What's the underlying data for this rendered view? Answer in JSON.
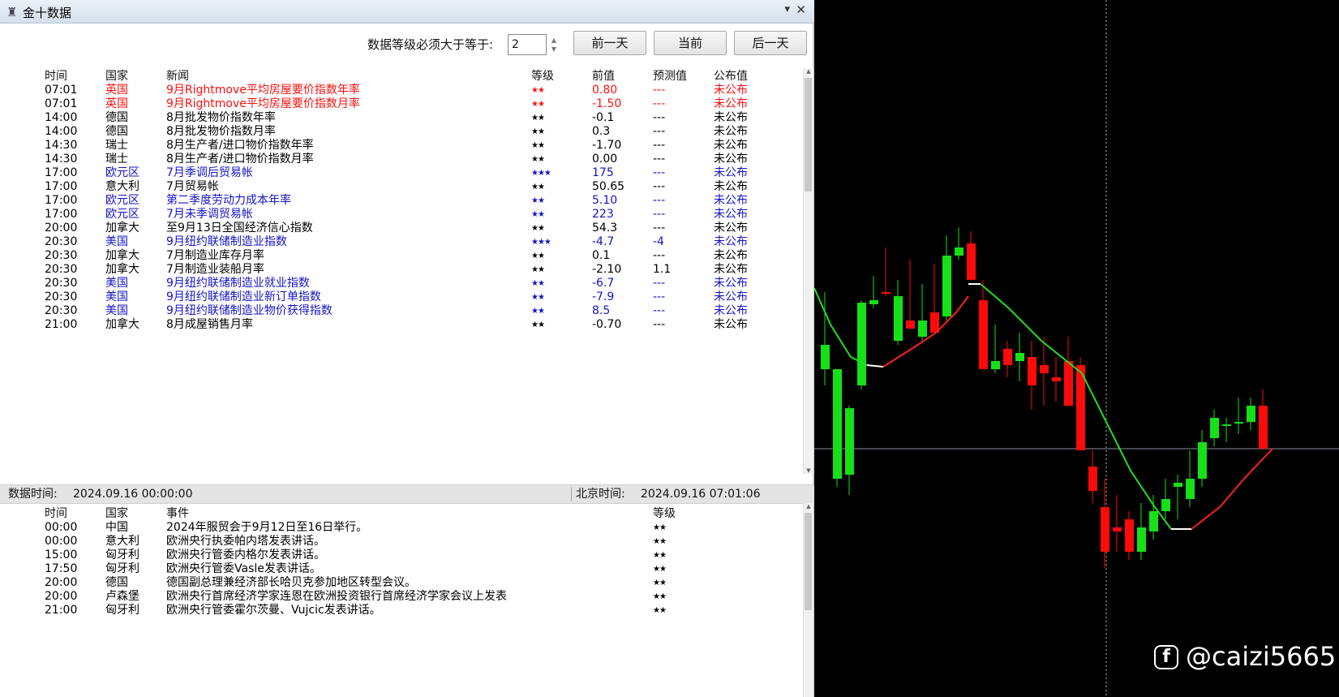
{
  "window": {
    "title": "金十数据",
    "pin_glyph": "▾",
    "close_glyph": "✕"
  },
  "filter": {
    "label": "数据等级必须大于等于:",
    "value": "2"
  },
  "nav": {
    "prev": "前一天",
    "current": "当前",
    "next": "后一天"
  },
  "news_headers": {
    "time": "时间",
    "country": "国家",
    "news": "新闻",
    "level": "等级",
    "prev": "前值",
    "forecast": "预测值",
    "published": "公布值"
  },
  "news_rows": [
    {
      "time": "07:01",
      "country": "英国",
      "news": "9月Rightmove平均房屋要价指数年率",
      "level": "★★",
      "prev": "0.80",
      "forecast": "---",
      "published": "未公布",
      "color": "red"
    },
    {
      "time": "07:01",
      "country": "英国",
      "news": "9月Rightmove平均房屋要价指数月率",
      "level": "★★",
      "prev": "-1.50",
      "forecast": "---",
      "published": "未公布",
      "color": "red"
    },
    {
      "time": "14:00",
      "country": "德国",
      "news": "8月批发物价指数年率",
      "level": "★★",
      "prev": "-0.1",
      "forecast": "---",
      "published": "未公布",
      "color": "black"
    },
    {
      "time": "14:00",
      "country": "德国",
      "news": "8月批发物价指数月率",
      "level": "★★",
      "prev": "0.3",
      "forecast": "---",
      "published": "未公布",
      "color": "black"
    },
    {
      "time": "14:30",
      "country": "瑞士",
      "news": "8月生产者/进口物价指数年率",
      "level": "★★",
      "prev": "-1.70",
      "forecast": "---",
      "published": "未公布",
      "color": "black"
    },
    {
      "time": "14:30",
      "country": "瑞士",
      "news": "8月生产者/进口物价指数月率",
      "level": "★★",
      "prev": "0.00",
      "forecast": "---",
      "published": "未公布",
      "color": "black"
    },
    {
      "time": "17:00",
      "country": "欧元区",
      "news": "7月季调后贸易帐",
      "level": "★★★",
      "prev": "175",
      "forecast": "---",
      "published": "未公布",
      "color": "blue"
    },
    {
      "time": "17:00",
      "country": "意大利",
      "news": "7月贸易帐",
      "level": "★★",
      "prev": "50.65",
      "forecast": "---",
      "published": "未公布",
      "color": "black"
    },
    {
      "time": "17:00",
      "country": "欧元区",
      "news": "第二季度劳动力成本年率",
      "level": "★★",
      "prev": "5.10",
      "forecast": "---",
      "published": "未公布",
      "color": "blue"
    },
    {
      "time": "17:00",
      "country": "欧元区",
      "news": "7月未季调贸易帐",
      "level": "★★",
      "prev": "223",
      "forecast": "---",
      "published": "未公布",
      "color": "blue"
    },
    {
      "time": "20:00",
      "country": "加拿大",
      "news": "至9月13日全国经济信心指数",
      "level": "★★",
      "prev": "54.3",
      "forecast": "---",
      "published": "未公布",
      "color": "black"
    },
    {
      "time": "20:30",
      "country": "美国",
      "news": "9月纽约联储制造业指数",
      "level": "★★★",
      "prev": "-4.7",
      "forecast": "-4",
      "published": "未公布",
      "color": "blue"
    },
    {
      "time": "20:30",
      "country": "加拿大",
      "news": "7月制造业库存月率",
      "level": "★★",
      "prev": "0.1",
      "forecast": "---",
      "published": "未公布",
      "color": "black"
    },
    {
      "time": "20:30",
      "country": "加拿大",
      "news": "7月制造业装船月率",
      "level": "★★",
      "prev": "-2.10",
      "forecast": "1.1",
      "published": "未公布",
      "color": "black"
    },
    {
      "time": "20:30",
      "country": "美国",
      "news": "9月纽约联储制造业就业指数",
      "level": "★★",
      "prev": "-6.7",
      "forecast": "---",
      "published": "未公布",
      "color": "blue"
    },
    {
      "time": "20:30",
      "country": "美国",
      "news": "9月纽约联储制造业新订单指数",
      "level": "★★",
      "prev": "-7.9",
      "forecast": "---",
      "published": "未公布",
      "color": "blue"
    },
    {
      "time": "20:30",
      "country": "美国",
      "news": "9月纽约联储制造业物价获得指数",
      "level": "★★",
      "prev": "8.5",
      "forecast": "---",
      "published": "未公布",
      "color": "blue"
    },
    {
      "time": "21:00",
      "country": "加拿大",
      "news": "8月成屋销售月率",
      "level": "★★",
      "prev": "-0.70",
      "forecast": "---",
      "published": "未公布",
      "color": "black"
    }
  ],
  "status": {
    "data_time_label": "数据时间:",
    "data_time": "2024.09.16 00:00:00",
    "beijing_label": "北京时间:",
    "beijing_time": "2024.09.16 07:01:06"
  },
  "event_headers": {
    "time": "时间",
    "country": "国家",
    "event": "事件",
    "level": "等级"
  },
  "event_rows": [
    {
      "time": "00:00",
      "country": "中国",
      "event": "2024年服贸会于9月12日至16日举行。",
      "level": "★★"
    },
    {
      "time": "00:00",
      "country": "意大利",
      "event": "欧洲央行执委帕内塔发表讲话。",
      "level": "★★"
    },
    {
      "time": "15:00",
      "country": "匈牙利",
      "event": "欧洲央行管委内格尔发表讲话。",
      "level": "★★"
    },
    {
      "time": "17:50",
      "country": "匈牙利",
      "event": "欧洲央行管委Vasle发表讲话。",
      "level": "★★"
    },
    {
      "time": "20:00",
      "country": "德国",
      "event": "德国副总理兼经济部长哈贝克参加地区转型会议。",
      "level": "★★"
    },
    {
      "time": "20:00",
      "country": "卢森堡",
      "event": "欧洲央行首席经济学家连恩在欧洲投资银行首席经济学家会议上发表",
      "level": "★★"
    },
    {
      "time": "21:00",
      "country": "匈牙利",
      "event": "欧洲央行管委霍尔茨曼、Vujcic发表讲话。",
      "level": "★★"
    }
  ],
  "watermark": {
    "icon": "f",
    "text": "@caizi5665"
  },
  "colors": {
    "red": "#ff1010",
    "blue": "#1414c8",
    "bull": "#16e016",
    "bear": "#ff0a0a",
    "ma_up": "#22dd22",
    "ma_down": "#ff2020"
  }
}
